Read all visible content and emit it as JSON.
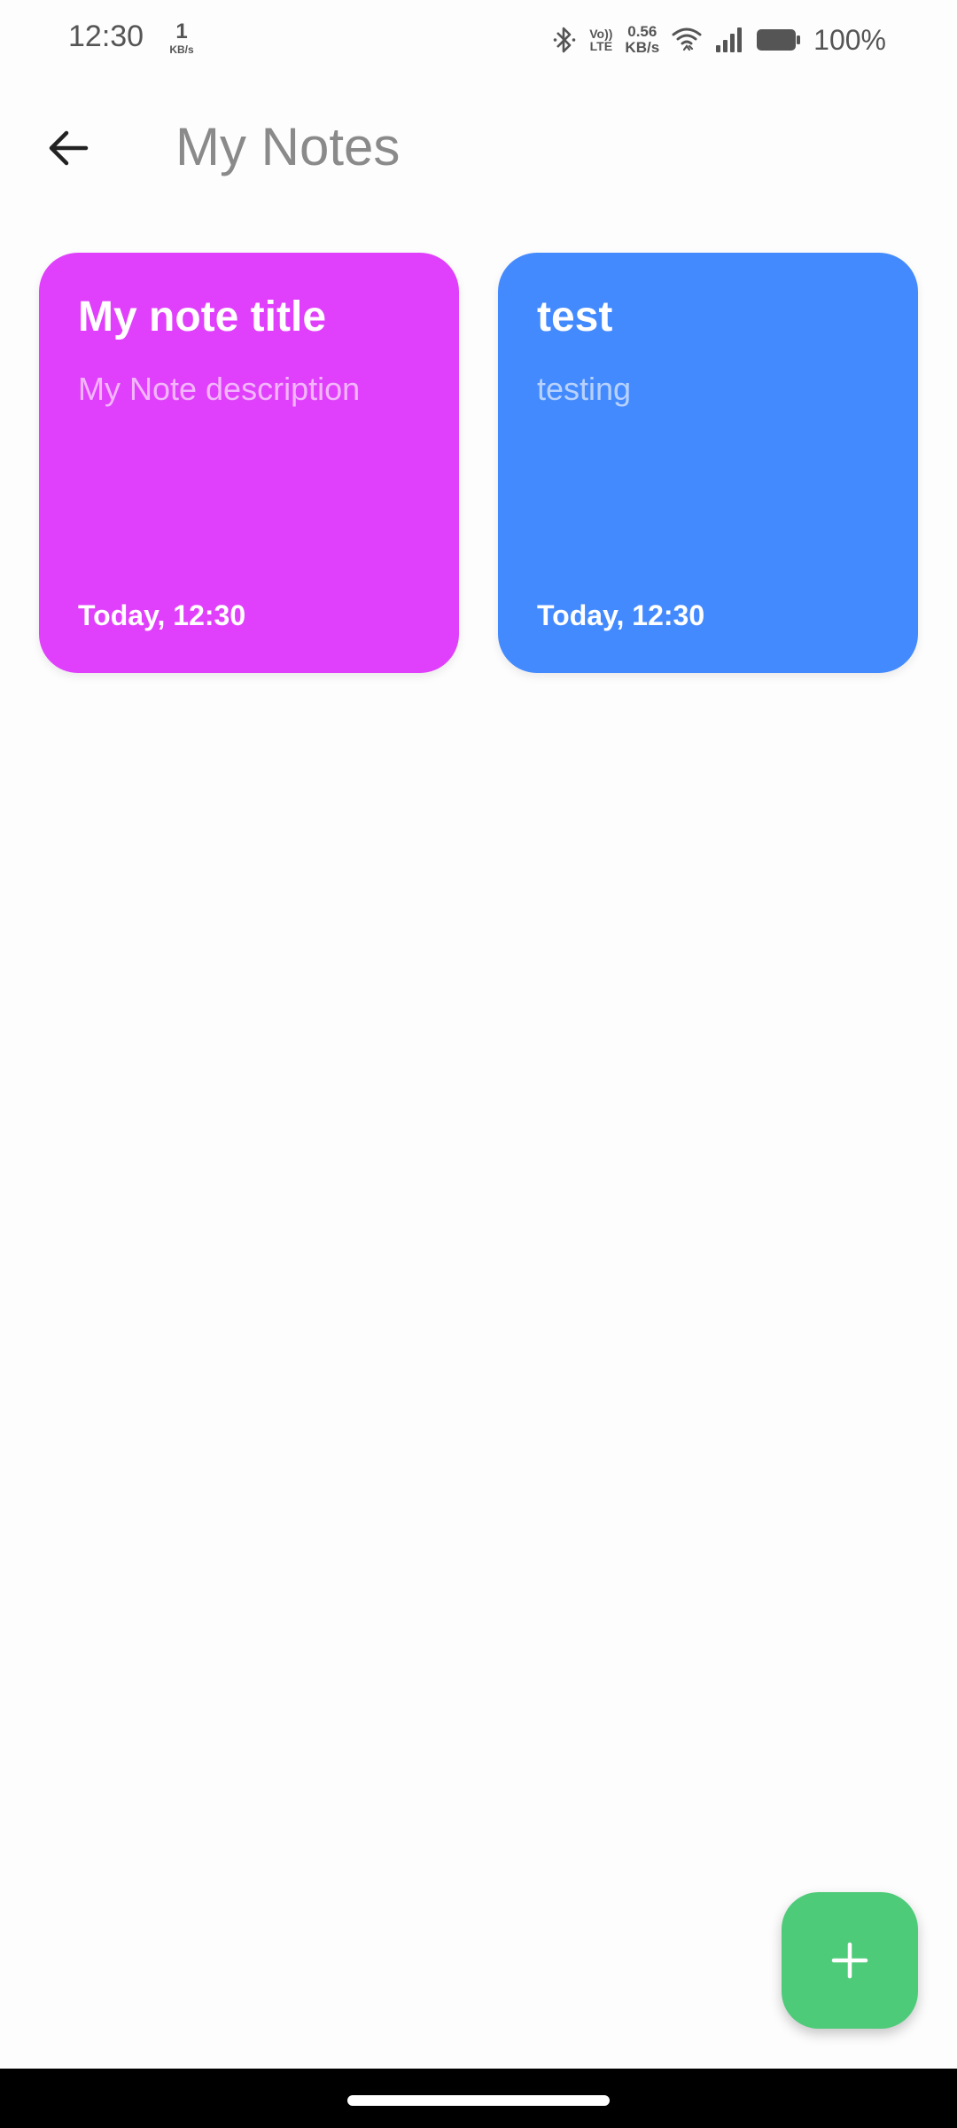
{
  "status_bar": {
    "time": "12:30",
    "speed_left_value": "1",
    "speed_left_unit": "KB/s",
    "volte_top": "Vo))",
    "volte_bottom": "LTE",
    "speed_right_value": "0.56",
    "speed_right_unit": "KB/s",
    "battery_percent": "100%",
    "icons": [
      "bluetooth-icon",
      "volte-icon",
      "wifi-icon",
      "signal-icon",
      "battery-icon"
    ]
  },
  "app_bar": {
    "back_icon": "arrow-left-icon",
    "title": "My Notes"
  },
  "notes": [
    {
      "title": "My note title",
      "description": "My Note description",
      "timestamp": "Today, 12:30",
      "color": "#e040fb"
    },
    {
      "title": "test",
      "description": "testing",
      "timestamp": "Today, 12:30",
      "color": "#448aff"
    }
  ],
  "fab": {
    "icon": "plus-icon",
    "color": "#4ecb79"
  }
}
